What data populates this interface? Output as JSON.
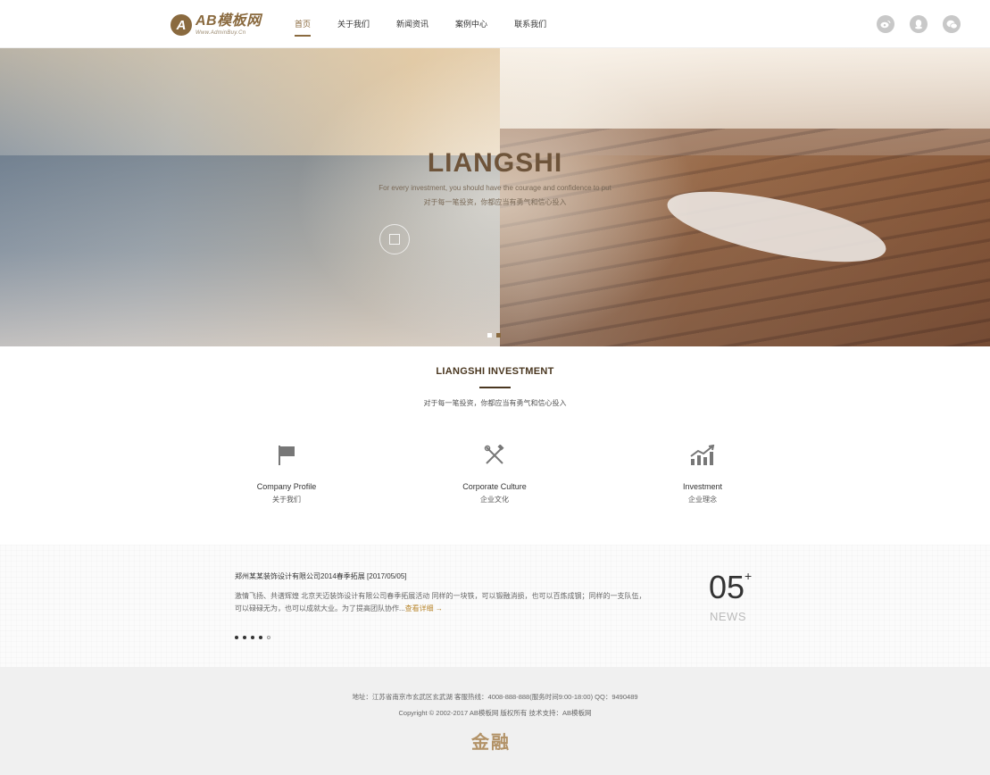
{
  "header": {
    "logo": {
      "mark": "A",
      "title": "AB模板网",
      "subtitle": "Www.AdminBuy.Cn"
    },
    "nav": [
      {
        "label": "首页",
        "active": true
      },
      {
        "label": "关于我们",
        "active": false
      },
      {
        "label": "新闻资讯",
        "active": false
      },
      {
        "label": "案例中心",
        "active": false
      },
      {
        "label": "联系我们",
        "active": false
      }
    ],
    "social_icons": [
      "weibo-icon",
      "qq-icon",
      "wechat-icon"
    ]
  },
  "banner": {
    "title": "LIANGSHI",
    "subtitle_en": "For every investment, you should have the courage and confidence to put",
    "subtitle_cn": "对于每一笔投资，你都应当有勇气和信心投入",
    "slides": 2,
    "active_slide": 1
  },
  "investment": {
    "title": "LIANGSHI INVESTMENT",
    "subtitle": "对于每一笔投资，你都应当有勇气和信心投入",
    "features": [
      {
        "icon": "flag-icon",
        "en": "Company Profile",
        "cn": "关于我们"
      },
      {
        "icon": "tools-icon",
        "en": "Corporate Culture",
        "cn": "企业文化"
      },
      {
        "icon": "chart-growth-icon",
        "en": "Investment",
        "cn": "企业理念"
      }
    ]
  },
  "news": {
    "title": "郑州某某装饰设计有限公司2014春季拓展 [2017/05/05]",
    "body": "激情飞扬、共谱辉煌 北京天迈装饰设计有限公司春季拓展活动 同样的一块铁，可以锻融消损，也可以百炼成钢；同样的一支队伍，可以碌碌无为，也可以成就大业。为了提高团队协作...",
    "more": "查看详细 →",
    "count": "05",
    "count_suffix": "+",
    "label": "NEWS",
    "dots": 5,
    "active_dot": 4
  },
  "footer": {
    "address": "地址：江苏省南京市玄武区玄武湖 客服热线：4008-888-888(服务时间9:00-18:00) QQ：9490489",
    "copyright": "Copyright © 2002-2017 AB模板网 版权所有 技术支持：AB模板网",
    "logo_text": "金融"
  },
  "colors": {
    "accent": "#8a6a3f",
    "dark": "#4a3720",
    "footer_bg": "#f0f0f0"
  }
}
